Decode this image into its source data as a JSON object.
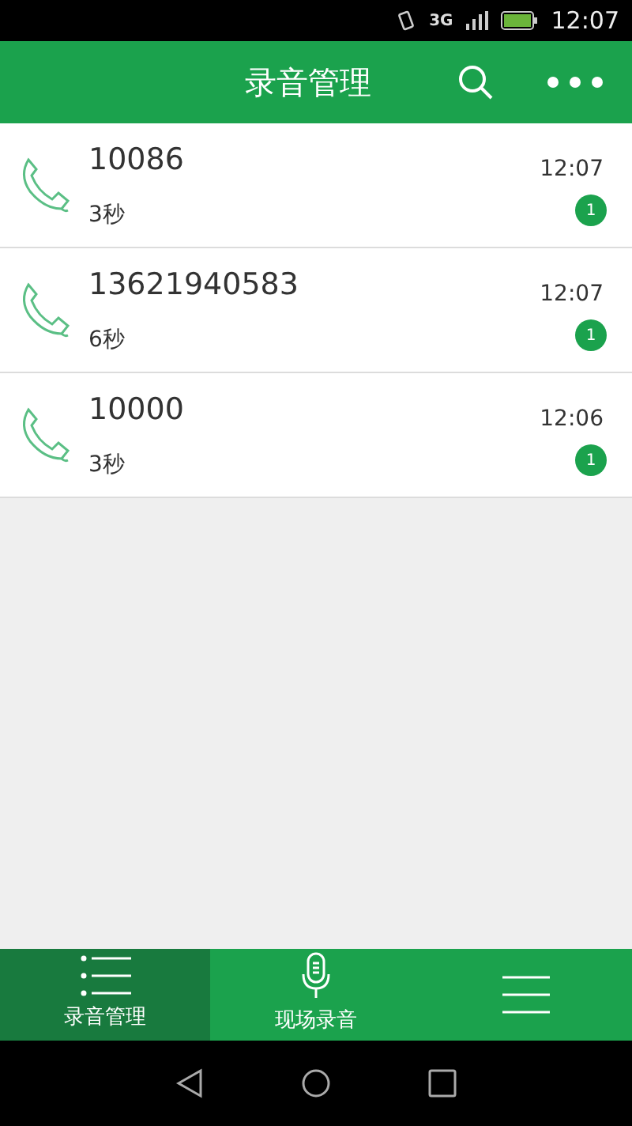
{
  "status_bar": {
    "network": "3G",
    "time": "12:07"
  },
  "header": {
    "title": "录音管理"
  },
  "recordings": [
    {
      "number": "10086",
      "duration": "3秒",
      "time": "12:07",
      "count": "1"
    },
    {
      "number": "13621940583",
      "duration": "6秒",
      "time": "12:07",
      "count": "1"
    },
    {
      "number": "10000",
      "duration": "3秒",
      "time": "12:06",
      "count": "1"
    }
  ],
  "tabs": [
    {
      "label": "录音管理",
      "selected": true
    },
    {
      "label": "现场录音",
      "selected": false
    },
    {
      "selected": false
    }
  ]
}
